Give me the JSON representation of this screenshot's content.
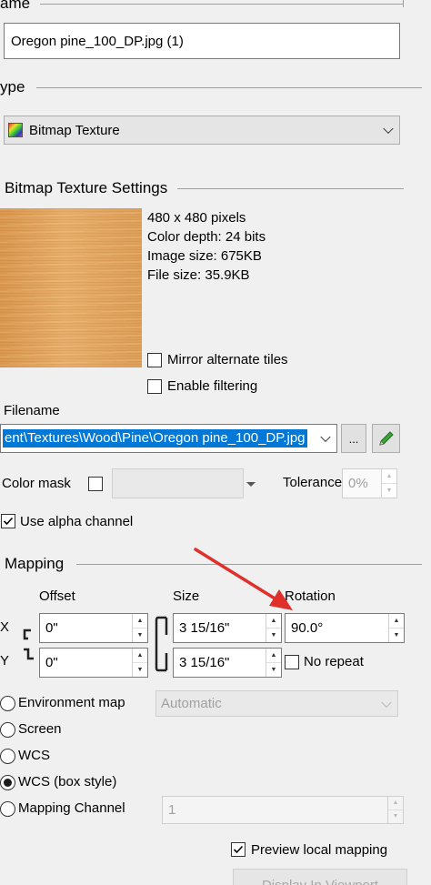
{
  "name_section": {
    "label": "ame",
    "value": "Oregon pine_100_DP.jpg (1)"
  },
  "type_section": {
    "label": "ype",
    "selected": "Bitmap Texture"
  },
  "bitmap": {
    "title": "Bitmap Texture Settings",
    "info": [
      "480 x 480 pixels",
      "Color depth: 24 bits",
      "Image size: 675KB",
      "File size: 35.9KB"
    ],
    "mirror_label": "Mirror alternate tiles",
    "filtering_label": "Enable filtering",
    "filename_label": "Filename",
    "filename_value": "ent\\Textures\\Wood\\Pine\\Oregon pine_100_DP.jpg",
    "browse_label": "...",
    "color_mask_label": "Color mask",
    "tolerance_label": "Tolerance",
    "tolerance_value": "0%",
    "alpha_label": "Use alpha channel"
  },
  "mapping": {
    "title": "Mapping",
    "offset_label": "Offset",
    "size_label": "Size",
    "rotation_label": "Rotation",
    "x_label": "X",
    "y_label": "Y",
    "offset_x": "0\"",
    "offset_y": "0\"",
    "size_x": "3 15/16\"",
    "size_y": "3 15/16\"",
    "rotation": "90.0°",
    "no_repeat_label": "No repeat",
    "options": [
      {
        "label": "Environment map",
        "selected": false
      },
      {
        "label": "Screen",
        "selected": false
      },
      {
        "label": "WCS",
        "selected": false
      },
      {
        "label": "WCS (box style)",
        "selected": true
      },
      {
        "label": "Mapping Channel",
        "selected": false
      }
    ],
    "env_map_value": "Automatic",
    "channel_value": "1",
    "preview_label": "Preview local mapping",
    "display_button": "Display In Viewport"
  },
  "colors": {
    "selection": "#0078d7",
    "arrow": "#e0302b",
    "wood": "#e0a35e"
  },
  "icons": {
    "texture": "bitmap-texture-icon",
    "pencil": "pencil-icon",
    "link": "link-bracket-icon"
  }
}
